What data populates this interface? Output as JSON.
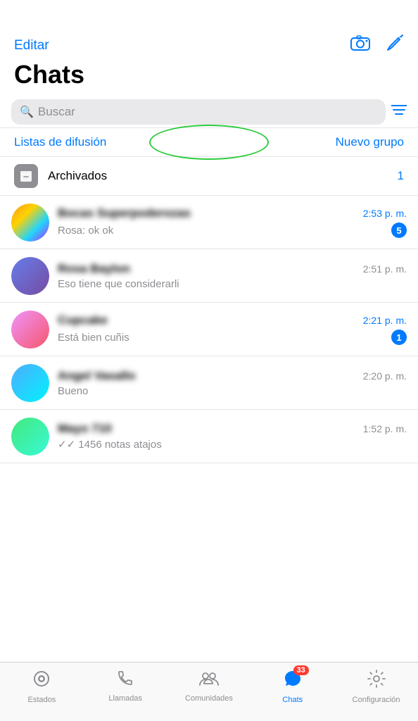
{
  "header": {
    "edit_label": "Editar",
    "title": "Chats"
  },
  "search": {
    "placeholder": "Buscar"
  },
  "actions": {
    "broadcast": "Listas de difusión",
    "new_group": "Nuevo grupo"
  },
  "archived": {
    "label": "Archivados",
    "count": "1"
  },
  "chats": [
    {
      "id": 1,
      "name": "Bocas Superpoderozas",
      "preview": "Rosa: ok ok",
      "time": "2:53 p. m.",
      "time_blue": true,
      "badge": "5",
      "avatar_class": "av1"
    },
    {
      "id": 2,
      "name": "Rosa Baylon",
      "preview": "Eso tiene que considerarli",
      "time": "2:51 p. m.",
      "time_blue": false,
      "badge": null,
      "avatar_class": "av2"
    },
    {
      "id": 3,
      "name": "Cupcake",
      "preview": "Está bien cuñis",
      "time": "2:21 p. m.",
      "time_blue": true,
      "badge": "1",
      "avatar_class": "av3"
    },
    {
      "id": 4,
      "name": "Angel Vasallo",
      "preview": "Bueno",
      "time": "2:20 p. m.",
      "time_blue": false,
      "badge": null,
      "avatar_class": "av4"
    },
    {
      "id": 5,
      "name": "Mayo 710",
      "preview": "✓✓ 1456 notas atajos",
      "time": "1:52 p. m.",
      "time_blue": false,
      "badge": null,
      "avatar_class": "av5"
    }
  ],
  "tabs": [
    {
      "id": "estados",
      "label": "Estados",
      "icon": "⊙",
      "active": false,
      "badge": null
    },
    {
      "id": "llamadas",
      "label": "Llamadas",
      "icon": "✆",
      "active": false,
      "badge": null
    },
    {
      "id": "comunidades",
      "label": "Comunidades",
      "icon": "⚉",
      "active": false,
      "badge": null
    },
    {
      "id": "chats",
      "label": "Chats",
      "icon": "💬",
      "active": true,
      "badge": "33"
    },
    {
      "id": "configuracion",
      "label": "Configuración",
      "icon": "⚙",
      "active": false,
      "badge": null
    }
  ]
}
